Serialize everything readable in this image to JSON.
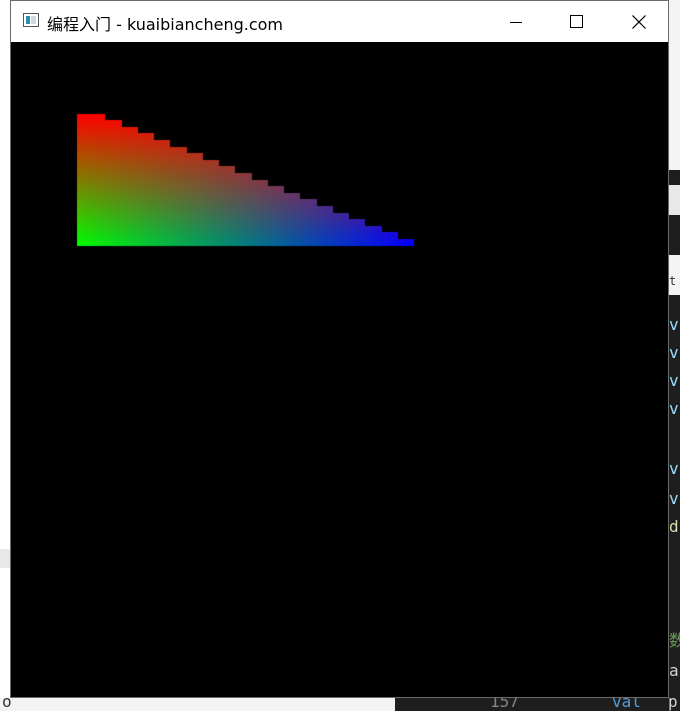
{
  "window": {
    "title": "编程入门 - kuaibiancheng.com",
    "icons": {
      "app": "app-window-icon",
      "minimize": "minimize-icon",
      "maximize": "maximize-icon",
      "close": "close-icon"
    }
  },
  "canvas": {
    "background": "#000000",
    "shape": "triangle",
    "vertex_colors": {
      "top": "#ff0000",
      "bottom_left": "#00ff00",
      "bottom_right": "#0000ff"
    }
  },
  "background_editor": {
    "right_chars": [
      "t",
      "v",
      "v",
      "v",
      "v",
      "v",
      "v",
      "d"
    ],
    "bottom_text": [
      "o",
      "157",
      "val",
      "p"
    ]
  }
}
